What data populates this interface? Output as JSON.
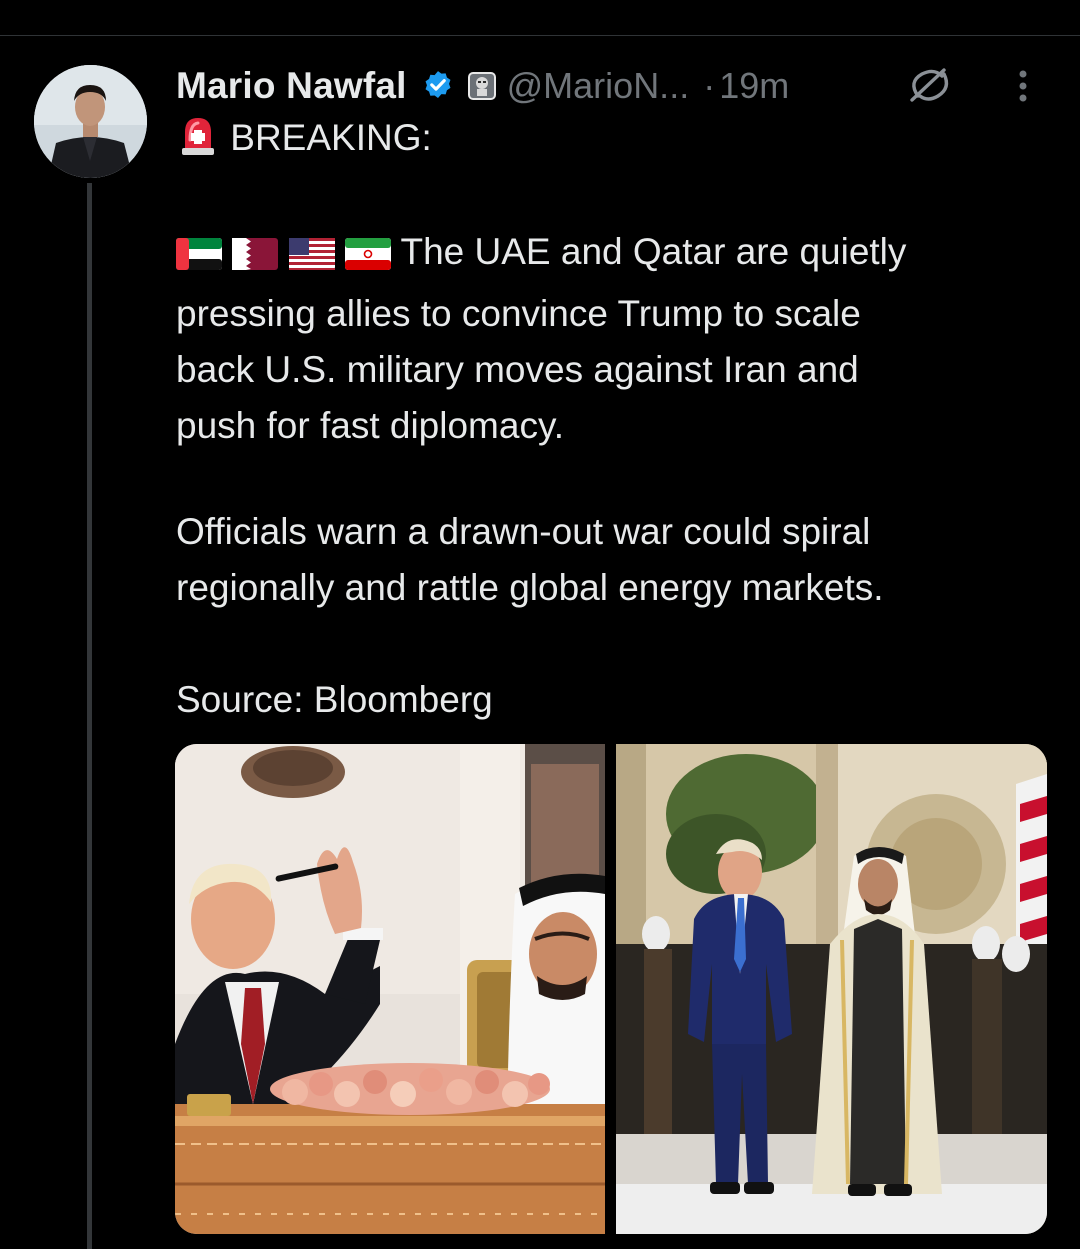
{
  "tweet": {
    "author_name": "Mario Nawfal",
    "handle": "@MarioN...",
    "separator": "·",
    "time": "19m",
    "breaking_label": "BREAKING:",
    "lines_paragraph_1": [
      "The UAE and Qatar are quietly",
      "pressing allies to convince Trump to scale",
      "back U.S. military moves against Iran and",
      "push for fast diplomacy."
    ],
    "lines_paragraph_2": [
      "Officials warn a drawn-out war could spiral",
      "regionally and rattle global energy markets."
    ],
    "source_line": "Source: Bloomberg",
    "flags": [
      "uae-flag",
      "qatar-flag",
      "usa-flag",
      "iran-flag"
    ],
    "icons": {
      "verified": "verified-badge-icon",
      "affiliate": "affiliate-badge-icon",
      "grok": "grok-icon",
      "more": "more-vertical-icon",
      "siren": "siren-emoji-icon"
    }
  },
  "media": {
    "photos": [
      "photo-signing-ceremony",
      "photo-walking-palace"
    ]
  },
  "colors": {
    "background": "#000000",
    "text": "#e7e9ea",
    "secondary_text": "#71767b",
    "verified_blue": "#1d9bf0",
    "divider": "#2f3336"
  }
}
